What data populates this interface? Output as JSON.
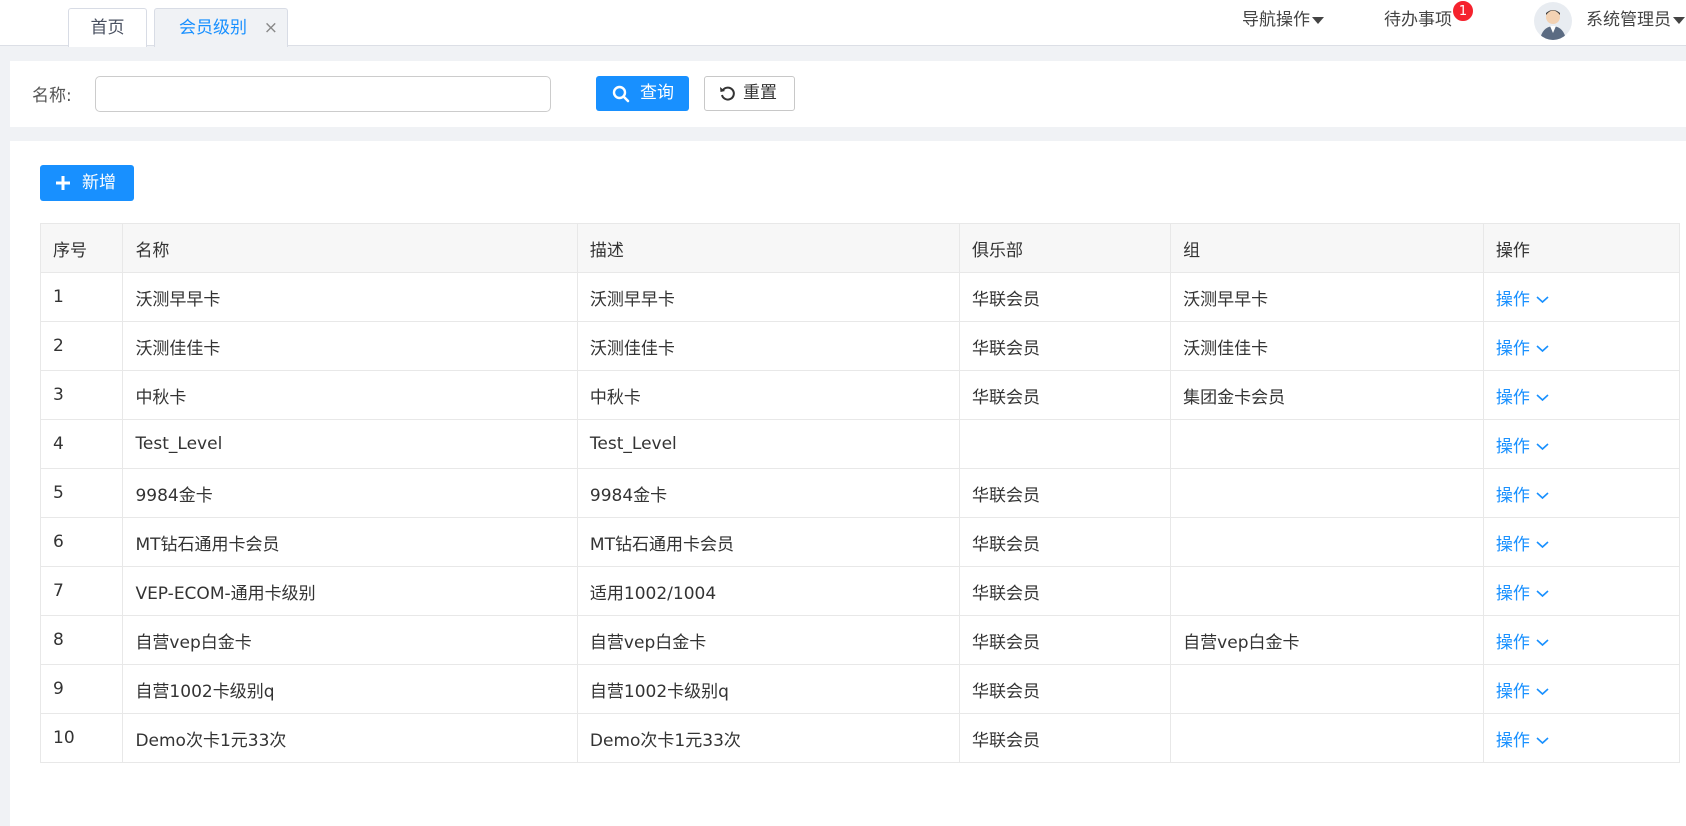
{
  "tabs": {
    "home": "首页",
    "active": "会员级别",
    "close": "×"
  },
  "header": {
    "nav_ops": "导航操作",
    "todo": "待办事项",
    "todo_count": "1",
    "user": "系统管理员"
  },
  "search": {
    "label": "名称:",
    "value": "",
    "placeholder": "",
    "query_label": "查询",
    "reset_label": "重置"
  },
  "toolbar": {
    "add_label": "新增"
  },
  "table": {
    "columns": [
      "序号",
      "名称",
      "描述",
      "俱乐部",
      "组",
      "操作"
    ],
    "action_label": "操作",
    "rows": [
      {
        "no": "1",
        "name": "沃测早早卡",
        "desc": "沃测早早卡",
        "club": "华联会员",
        "group": "沃测早早卡"
      },
      {
        "no": "2",
        "name": "沃测佳佳卡",
        "desc": "沃测佳佳卡",
        "club": "华联会员",
        "group": "沃测佳佳卡"
      },
      {
        "no": "3",
        "name": "中秋卡",
        "desc": "中秋卡",
        "club": "华联会员",
        "group": "集团金卡会员"
      },
      {
        "no": "4",
        "name": "Test_Level",
        "desc": "Test_Level",
        "club": "",
        "group": ""
      },
      {
        "no": "5",
        "name": "9984金卡",
        "desc": "9984金卡",
        "club": "华联会员",
        "group": ""
      },
      {
        "no": "6",
        "name": "MT钻石通用卡会员",
        "desc": "MT钻石通用卡会员",
        "club": "华联会员",
        "group": ""
      },
      {
        "no": "7",
        "name": "VEP-ECOM-通用卡级别",
        "desc": "适用1002/1004",
        "club": "华联会员",
        "group": ""
      },
      {
        "no": "8",
        "name": "自营vep白金卡",
        "desc": "自营vep白金卡",
        "club": "华联会员",
        "group": "自营vep白金卡"
      },
      {
        "no": "9",
        "name": "自营1002卡级别q",
        "desc": "自营1002卡级别q",
        "club": "华联会员",
        "group": ""
      },
      {
        "no": "10",
        "name": "Demo次卡1元33次",
        "desc": "Demo次卡1元33次",
        "club": "华联会员",
        "group": ""
      }
    ]
  },
  "colors": {
    "primary": "#1890ff",
    "badge": "#f5222d",
    "background": "#f0f2f5"
  },
  "icons": {
    "search": "search-icon",
    "reset": "refresh-icon",
    "add": "plus-icon",
    "chevron": "chevron-down-icon",
    "avatar": "user-avatar-icon"
  }
}
